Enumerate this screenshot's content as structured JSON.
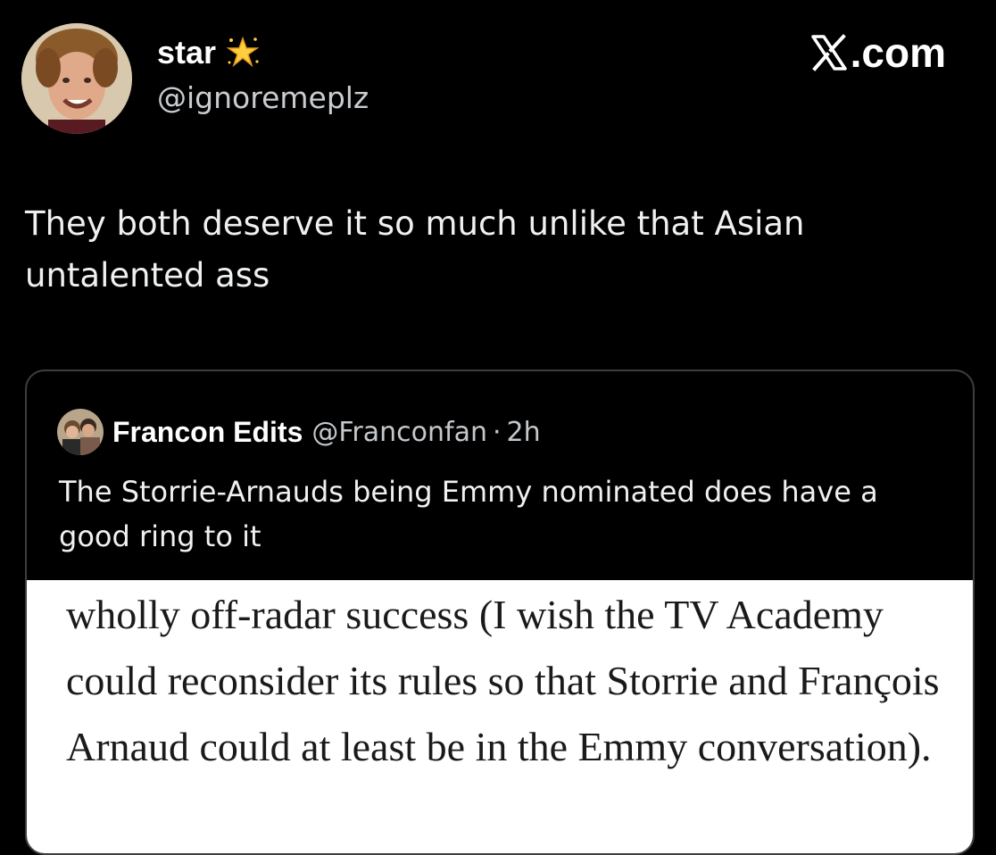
{
  "post": {
    "author": {
      "display_name": "star",
      "name_emoji": "glowing-star-icon",
      "handle": "@ignoremeplz"
    },
    "brand": {
      "icon": "x-logo-icon",
      "text": ".com"
    },
    "text": "They both deserve it so much unlike that Asian untalented ass"
  },
  "quoted_post": {
    "author": {
      "display_name": "Francon Edits",
      "handle": "@Franconfan",
      "separator": "·",
      "time": "2h"
    },
    "text": "The Storrie-Arnauds being Emmy nominated does have a good ring to it",
    "media_text": "wholly off-radar success (I wish the TV Academy could reconsider its rules so that Storrie and François Arnaud could at least be in the Emmy conversation)."
  },
  "colors": {
    "background": "#000000",
    "text_primary": "#e7e9ea",
    "text_secondary": "#c9cdd1",
    "card_border": "#3b3f43"
  }
}
